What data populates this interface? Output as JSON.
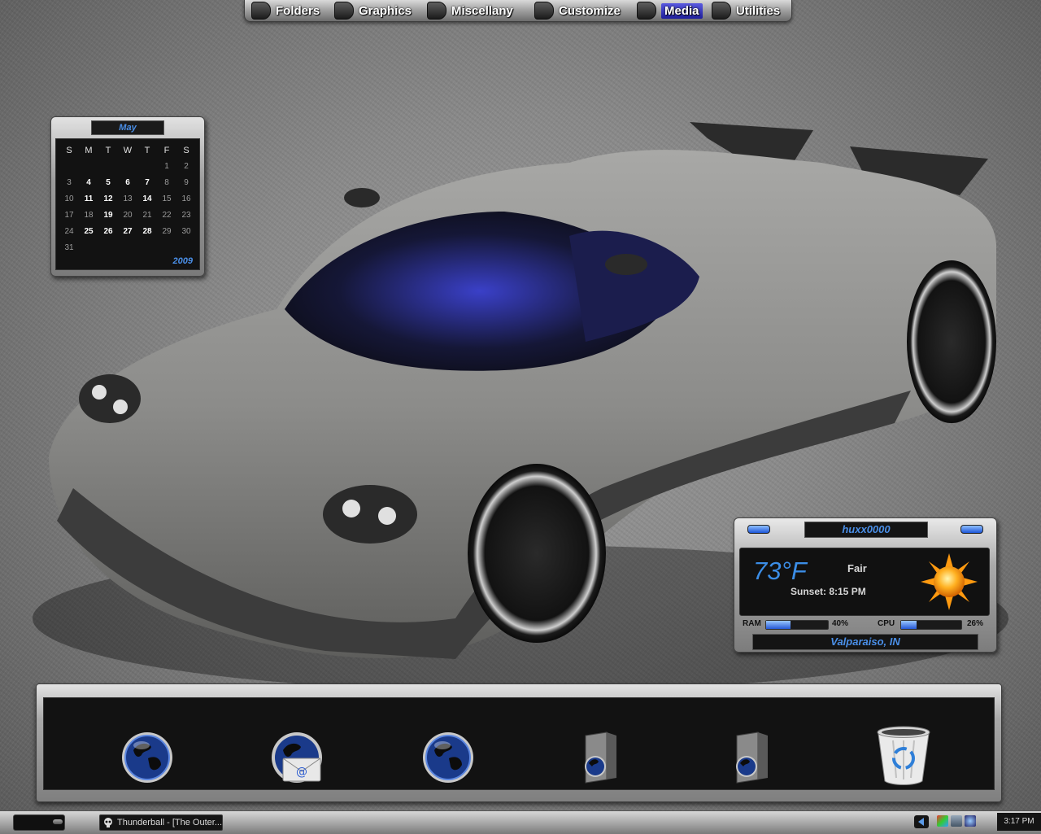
{
  "menu": {
    "items": [
      {
        "label": "Folders"
      },
      {
        "label": "Graphics"
      },
      {
        "label": "Miscellany"
      },
      {
        "label": "Customize"
      },
      {
        "label": "Media"
      },
      {
        "label": "Utilities"
      }
    ],
    "active": "Media"
  },
  "calendar": {
    "month": "May",
    "year": "2009",
    "weekdays": [
      "S",
      "M",
      "T",
      "W",
      "T",
      "F",
      "S"
    ],
    "weeks": [
      [
        "",
        "",
        "",
        "",
        "",
        "1",
        "2"
      ],
      [
        "3",
        "4",
        "5",
        "6",
        "7",
        "8",
        "9"
      ],
      [
        "10",
        "11",
        "12",
        "13",
        "14",
        "15",
        "16"
      ],
      [
        "17",
        "18",
        "19",
        "20",
        "21",
        "22",
        "23"
      ],
      [
        "24",
        "25",
        "26",
        "27",
        "28",
        "29",
        "30"
      ],
      [
        "31",
        "",
        "",
        "",
        "",
        "",
        ""
      ]
    ],
    "bold_days": [
      "4",
      "5",
      "6",
      "7",
      "11",
      "12",
      "14",
      "19",
      "25",
      "26",
      "27",
      "28"
    ]
  },
  "weather": {
    "user": "huxx0000",
    "temperature": "73°F",
    "condition": "Fair",
    "sunset": "Sunset: 8:15 PM",
    "ram_label": "RAM",
    "ram_value": "40%",
    "ram_fraction": 0.4,
    "cpu_label": "CPU",
    "cpu_value": "26%",
    "cpu_fraction": 0.26,
    "location": "Valparaiso, IN",
    "condition_icon": "sun-icon"
  },
  "dock": {
    "items": [
      {
        "icon": "globe-icon"
      },
      {
        "icon": "email-globe-icon"
      },
      {
        "icon": "globe-icon"
      },
      {
        "icon": "folder-globe-icon"
      },
      {
        "icon": "folder-globe-icon"
      },
      {
        "icon": "recycle-bin-icon"
      }
    ]
  },
  "taskbar": {
    "task_label": "Thunderball - [The Outer...",
    "clock": "3:17 PM"
  },
  "colors": {
    "accent_blue": "#3b8de6",
    "widget_dark": "#121212",
    "chrome_light": "#e0e0e0"
  }
}
